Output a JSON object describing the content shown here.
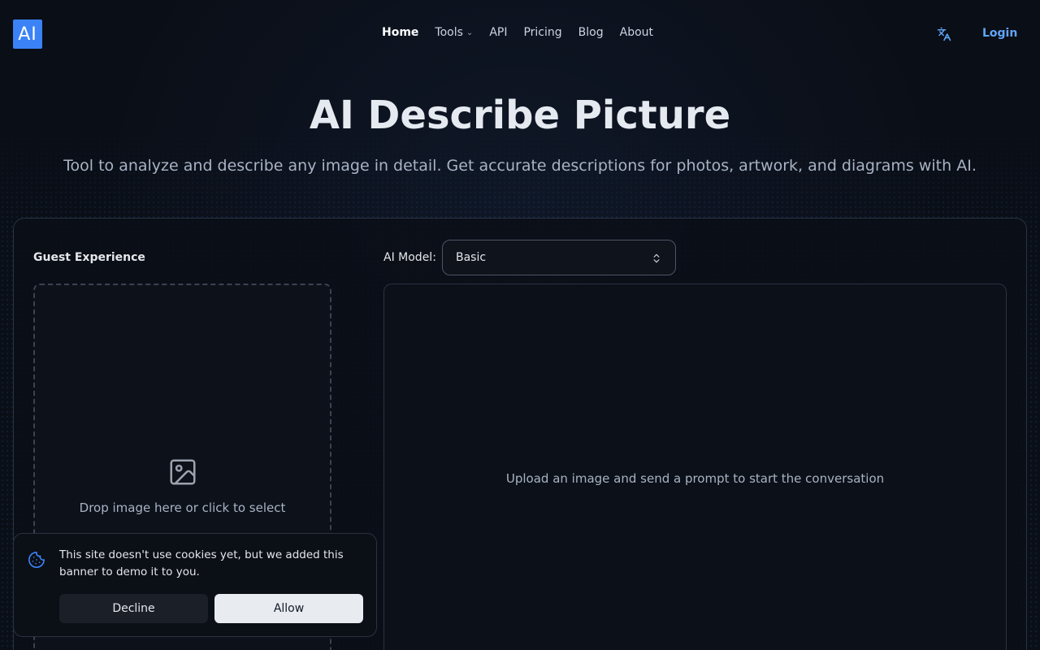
{
  "header": {
    "logo_text": "AI",
    "nav": [
      {
        "label": "Home",
        "active": true
      },
      {
        "label": "Tools",
        "has_dropdown": true
      },
      {
        "label": "API"
      },
      {
        "label": "Pricing"
      },
      {
        "label": "Blog"
      },
      {
        "label": "About"
      }
    ],
    "language_icon": "translate-icon",
    "login_label": "Login"
  },
  "hero": {
    "title": "AI Describe Picture",
    "subtitle": "Tool to analyze and describe any image in detail. Get accurate descriptions for photos, artwork, and diagrams with AI."
  },
  "tool": {
    "guest_label": "Guest Experience",
    "dropzone_icon": "image-icon",
    "dropzone_text": "Drop image here or click to select",
    "model_label": "AI Model:",
    "model_selected": "Basic",
    "chat_empty_text": "Upload an image and send a prompt to start the conversation"
  },
  "cookie_banner": {
    "icon": "cookie-icon",
    "text": "This site doesn't use cookies yet, but we added this banner to demo it to you.",
    "decline_label": "Decline",
    "allow_label": "Allow"
  },
  "colors": {
    "accent": "#3b82f6",
    "link": "#60a5fa",
    "background": "#0a0e16"
  }
}
